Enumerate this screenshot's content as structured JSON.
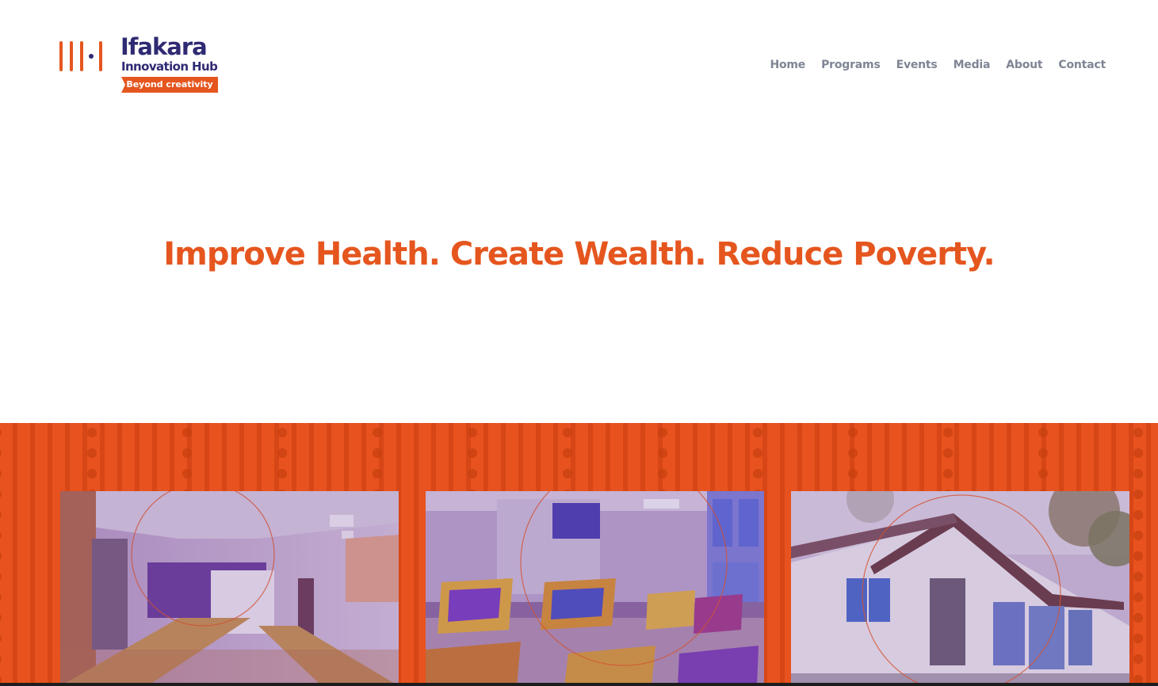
{
  "brand": {
    "name": "Ifakara",
    "subtitle": "Innovation Hub",
    "tagline": "Beyond creativity",
    "colors": {
      "orange": "#e5561f",
      "navy": "#2f2a73",
      "nav_gray": "#7f8594"
    }
  },
  "nav": {
    "items": [
      {
        "label": "Home"
      },
      {
        "label": "Programs"
      },
      {
        "label": "Events"
      },
      {
        "label": "Media"
      },
      {
        "label": "About"
      },
      {
        "label": "Contact"
      }
    ]
  },
  "hero": {
    "headline": "Improve Health. Create Wealth. Reduce Poverty."
  },
  "gallery": {
    "images": [
      {
        "subject": "training-room-photo"
      },
      {
        "subject": "classroom-chairs-photo"
      },
      {
        "subject": "hub-building-photo"
      }
    ]
  }
}
